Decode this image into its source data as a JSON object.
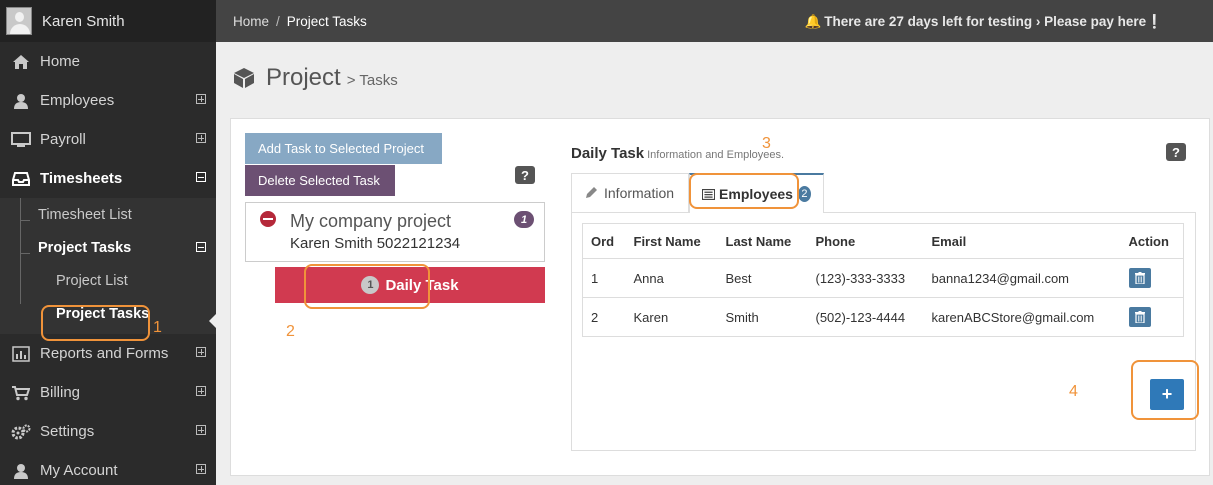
{
  "user": {
    "name": "Karen Smith"
  },
  "nav": {
    "home": "Home",
    "employees": "Employees",
    "payroll": "Payroll",
    "timesheets": "Timesheets",
    "timesheet_list": "Timesheet List",
    "project_tasks": "Project Tasks",
    "project_list": "Project List",
    "project_tasks_sub": "Project Tasks",
    "reports": "Reports and Forms",
    "billing": "Billing",
    "settings": "Settings",
    "my_account": "My Account"
  },
  "topbar": {
    "crumb_home": "Home",
    "crumb_sep": "/",
    "crumb_current": "Project Tasks",
    "notice": "There are 27 days left for testing › Please pay here❕"
  },
  "page": {
    "title": "Project",
    "subtitle": "> Tasks"
  },
  "buttons": {
    "add_task": "Add Task to Selected Project",
    "delete_task": "Delete Selected Task",
    "help": "?",
    "add_employee": "+"
  },
  "project": {
    "name": "My company project",
    "owner": "Karen Smith 5022121234",
    "task_count": "1"
  },
  "task": {
    "count": "1",
    "name": "Daily Task"
  },
  "detail": {
    "title": "Daily Task",
    "subtitle": "Information and Employees."
  },
  "tabs": {
    "information": "Information",
    "employees": "Employees",
    "employees_count": "2"
  },
  "table": {
    "headers": [
      "Ord",
      "First Name",
      "Last Name",
      "Phone",
      "Email",
      "Action"
    ],
    "rows": [
      {
        "ord": "1",
        "first": "Anna",
        "last": "Best",
        "phone": "(123)-333-3333",
        "email": "banna1234@gmail.com"
      },
      {
        "ord": "2",
        "first": "Karen",
        "last": "Smith",
        "phone": "(502)-123-4444",
        "email": "karenABCStore@gmail.com"
      }
    ]
  },
  "annotations": {
    "a1": "1",
    "a2": "2",
    "a3": "3",
    "a4": "4"
  },
  "colors": {
    "accent_orange": "#f0933a",
    "task_red": "#d13a50",
    "button_blue": "#2f79b8",
    "purple": "#6c5073"
  }
}
